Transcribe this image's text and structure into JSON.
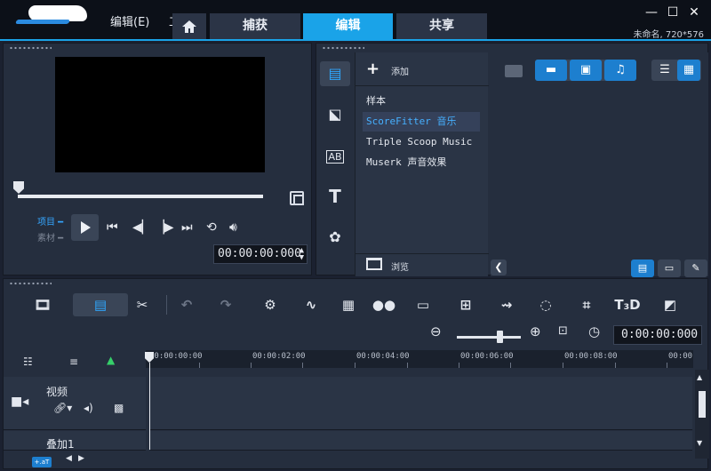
{
  "menu": {
    "edit_menu": "编辑(E)",
    "second_menu_fragment": "工"
  },
  "tabs": {
    "home_icon": "home-icon",
    "capture": "捕获",
    "edit": "编辑",
    "share": "共享"
  },
  "window": {
    "minimize": "—",
    "maximize": "☐",
    "close": "✕",
    "project_info": "未命名, 720*576"
  },
  "preview": {
    "mode_project": "项目",
    "mode_clip": "素材",
    "timecode": "00:00:00:000"
  },
  "library": {
    "add_label": "添加",
    "items": [
      "样本",
      "ScoreFitter 音乐",
      "Triple Scoop Music",
      "Muserk 声音效果"
    ],
    "selected_index": 1,
    "browse_label": "浏览"
  },
  "timeline": {
    "timecode": "0:00:00:000",
    "ruler_labels": [
      "00:00:00:00",
      "00:00:02:00",
      "00:00:04:00",
      "00:00:06:00",
      "00:00:08:00",
      "00:00"
    ],
    "tracks": [
      {
        "name": "视频",
        "icon": "video-camera-icon"
      },
      {
        "name": "叠加1",
        "icon": "overlay-icon"
      }
    ],
    "footer_badge": "+.aT"
  },
  "colors": {
    "accent": "#1aa3e8",
    "selected_blue": "#1d7fcf",
    "background": "#1b2130",
    "panel": "#252e3e"
  }
}
